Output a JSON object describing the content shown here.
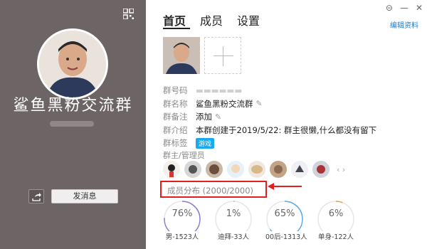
{
  "group": {
    "name": "鲨鱼黑粉交流群",
    "send_label": "发消息"
  },
  "tabs": [
    "首页",
    "成员",
    "设置"
  ],
  "edit_label": "编辑资料",
  "info": {
    "id_label": "群号码",
    "name_label": "群名称",
    "name_value": "鲨鱼黑粉交流群",
    "remark_label": "群备注",
    "remark_value": "添加",
    "intro_label": "群介绍",
    "intro_value": "本群创建于2019/5/22:  群主很懒,什么都没有留下",
    "tag_label": "群标签",
    "tag_value": "游戏"
  },
  "admins_label": "群主/管理员",
  "distribution": {
    "label": "成员分布 (2000/2000)",
    "items": [
      {
        "pct": "76%",
        "label": "男-1523人",
        "fraction": 0.76,
        "color": "#8a7bd6"
      },
      {
        "pct": "1%",
        "label": "迪拜-33人",
        "fraction": 0.01,
        "color": "#7ec0f0"
      },
      {
        "pct": "65%",
        "label": "00后-1313人",
        "fraction": 0.65,
        "color": "#5aa9e8"
      },
      {
        "pct": "6%",
        "label": "单身-122人",
        "fraction": 0.06,
        "color": "#f0a040"
      }
    ]
  }
}
